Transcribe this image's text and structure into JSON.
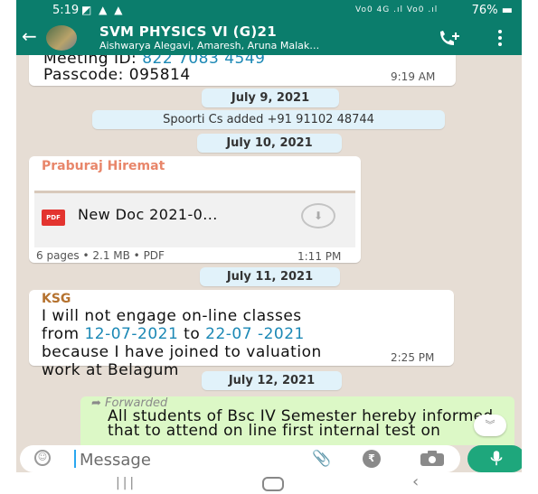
{
  "status_bar": {
    "time": "5:19",
    "network": "Vo0 4G .ıl Vo0 .ıl",
    "battery": "76%"
  },
  "header": {
    "title": "SVM PHYSICS VI (G)21",
    "members": "Aishwarya Alegavi, Amaresh, Aruna Malak…"
  },
  "messages": {
    "meeting": {
      "id_label": "Meeting ID:",
      "id_value": "822 7083 4549",
      "passcode": "Passcode: 095814",
      "time": "9:19 AM"
    },
    "date1": "July 9, 2021",
    "system1": "Spoorti Cs added +91 91102 48744",
    "date2": "July 10, 2021",
    "doc": {
      "sender": "Praburaj Hiremat",
      "badge": "PDF",
      "filename": "New Doc 2021-0...",
      "meta": "6 pages • 2.1 MB • PDF",
      "time": "1:11 PM"
    },
    "date3": "July 11, 2021",
    "ksg": {
      "sender": "KSG",
      "line1": "I will not engage on-line classes",
      "from": "from",
      "date_from": "12-07-2021",
      "to": "to",
      "date_to": "22-07 -2021",
      "line3": "because I have joined to valuation",
      "line4": "work at Belagum",
      "time": "2:25 PM"
    },
    "date4": "July 12, 2021",
    "forwarded": {
      "label": "Forwarded",
      "text": "All students of Bsc IV Semester hereby informed that to attend on line  first internal test on"
    }
  },
  "input": {
    "placeholder": "Message"
  },
  "colors": {
    "header": "#0b7d6c",
    "chat_bg": "#e6ddd4",
    "accent": "#1ea77c",
    "link": "#1b88b5",
    "sender_doc": "#e8866a",
    "sender_ksg": "#b5722f"
  }
}
